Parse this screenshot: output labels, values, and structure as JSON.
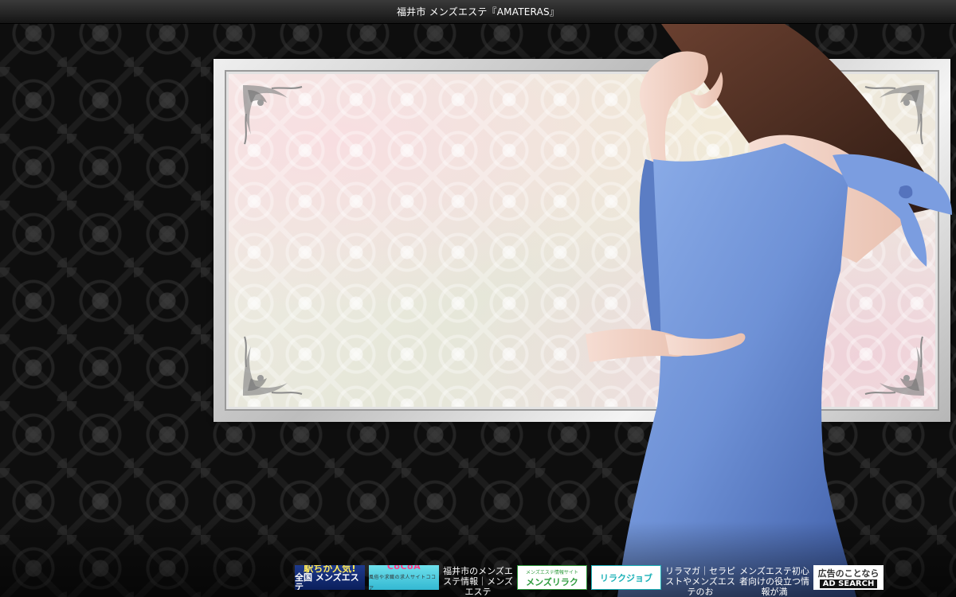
{
  "header": {
    "title": "福井市 メンズエステ『AMATERAS』"
  },
  "banners": [
    {
      "name": "eki-ninki",
      "lines": [
        "駅ちか人気!",
        "全国 メンズエステ"
      ],
      "colors": [
        "#1e3a8c",
        "#ffe95a"
      ]
    },
    {
      "name": "cocoa",
      "lines": [
        "CoCoA",
        "風俗や求職の求人サイトココア"
      ],
      "colors": [
        "#33b8d2",
        "#ff3d8b"
      ]
    },
    {
      "alt": "福井市のメンズエステ情報｜メンズエステ"
    },
    {
      "name": "menzu-riraku",
      "lines": [
        "メンズエステ情報サイト",
        "メンズリラク"
      ],
      "colors": [
        "#2f9b3d"
      ]
    },
    {
      "name": "riraku-job",
      "lines": [
        "リラクジョブ"
      ],
      "colors": [
        "#1bb1b7"
      ]
    },
    {
      "alt": "リラマガ｜セラピストやメンズエステのお"
    },
    {
      "alt": "メンズエステ初心者向けの役立つ情報が満"
    },
    {
      "name": "ad-search",
      "lines": [
        "広告のことなら",
        "AD SEARCH"
      ],
      "colors": [
        "#111111",
        "#d9261c"
      ]
    }
  ],
  "theme": {
    "background": "#0e0e0e",
    "title_text": "#ffffff",
    "frame": "#d8d8d8"
  }
}
